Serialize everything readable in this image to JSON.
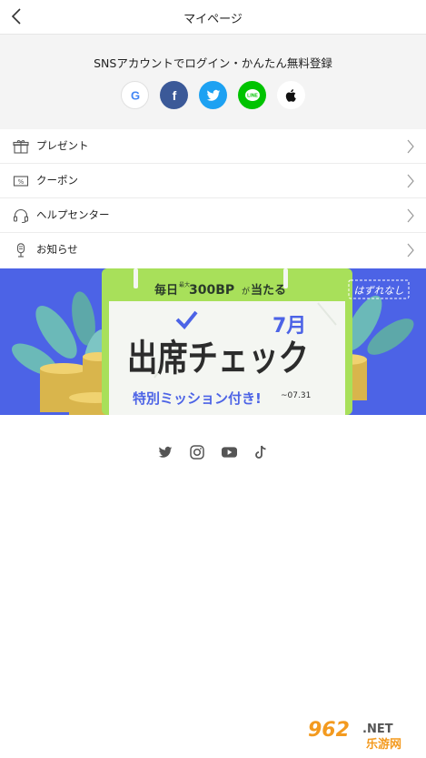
{
  "header": {
    "title": "マイページ"
  },
  "sns": {
    "title": "SNSアカウントでログイン・かんたん無料登録",
    "buttons": [
      {
        "name": "google",
        "icon": "google-icon",
        "glyph": "G"
      },
      {
        "name": "facebook",
        "icon": "facebook-icon",
        "glyph": "f"
      },
      {
        "name": "twitter",
        "icon": "twitter-icon"
      },
      {
        "name": "line",
        "icon": "line-icon",
        "glyph": "LINE"
      },
      {
        "name": "apple",
        "icon": "apple-icon"
      }
    ]
  },
  "menu": {
    "items": [
      {
        "label": "プレゼント",
        "icon": "gift-icon"
      },
      {
        "label": "クーポン",
        "icon": "coupon-icon",
        "icon_text": "%"
      },
      {
        "label": "ヘルプセンター",
        "icon": "headset-icon"
      },
      {
        "label": "お知らせ",
        "icon": "microphone-icon"
      }
    ]
  },
  "banner": {
    "top_text": "毎日最大300BPが当たる",
    "top_small": "最大",
    "top_daily": "毎日",
    "top_amount": "300BP",
    "top_ga": "が",
    "top_ataru": "当たる",
    "main_text": "出席チェック",
    "month": "7月",
    "sub_text": "特別ミッション付き!",
    "date": "~07.31",
    "tag": "はずれなし",
    "colors": {
      "background": "#4c63e6",
      "calendar_green": "#a8e05a",
      "coin": "#e8c65a"
    }
  },
  "social": {
    "icons": [
      "twitter-icon",
      "instagram-icon",
      "youtube-icon",
      "tiktok-icon"
    ]
  },
  "watermark": {
    "number": "962",
    "dot_net": ".NET",
    "chinese": "乐游网"
  }
}
